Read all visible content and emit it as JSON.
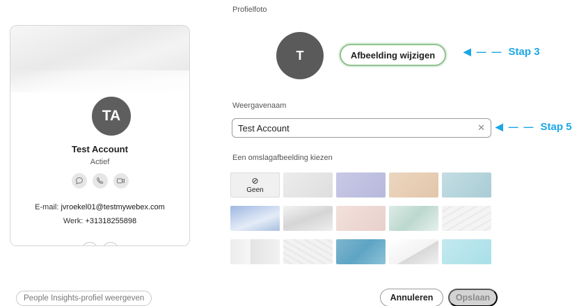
{
  "card": {
    "initials": "TA",
    "name": "Test Account",
    "status": "Actief",
    "email_label": "E-mail:",
    "email_value": "jvroekel01@testmywebex.com",
    "work_label": "Werk:",
    "work_value": "+31318255898",
    "icons": [
      "chat-icon",
      "phone-icon",
      "video-icon",
      "directory-icon",
      "mail-icon"
    ]
  },
  "insights_button": "People Insights-profiel weergeven",
  "profile_photo": {
    "label": "Profielfoto",
    "initial": "T",
    "change_button": "Afbeelding wijzigen"
  },
  "display_name": {
    "label": "Weergavenaam",
    "value": "Test Account"
  },
  "cover": {
    "label": "Een omslagafbeelding kiezen",
    "none_label": "Geen",
    "thumbnails": [
      {
        "name": "cover-none",
        "bg": "#f0f0f0"
      },
      {
        "name": "cover-light-grey",
        "bg": "linear-gradient(135deg,#ececec,#dedede)"
      },
      {
        "name": "cover-lavender",
        "bg": "linear-gradient(135deg,#c9c9e6,#b7b9dc)"
      },
      {
        "name": "cover-peach",
        "bg": "linear-gradient(135deg,#ecd6c0,#e2c6aa)"
      },
      {
        "name": "cover-teal-light",
        "bg": "linear-gradient(135deg,#c4dde3,#a9ccd5)"
      },
      {
        "name": "cover-blue-sky",
        "bg": "linear-gradient(160deg,#9fb7e2,#e4ecf7 60%,#a9bfdf)"
      },
      {
        "name": "cover-snow-peaks",
        "bg": "linear-gradient(160deg,#f3f3f3,#d5d5d5 50%,#eeeeee)"
      },
      {
        "name": "cover-blush",
        "bg": "linear-gradient(135deg,#f2e1dc,#e8d0cb)"
      },
      {
        "name": "cover-mint",
        "bg": "linear-gradient(135deg,#dcebe4,#bcd8cf 50%,#e6f0ec)"
      },
      {
        "name": "cover-white-curves",
        "bg": "repeating-linear-gradient(150deg,#f4f4f4 0px,#f4f4f4 6px,#e6e6e6 7px,#f4f4f4 9px)"
      },
      {
        "name": "cover-grey-panels",
        "bg": "linear-gradient(90deg,#ececec,#f6f6f6 40%,#e4e4e4 41%,#f1f1f1)"
      },
      {
        "name": "cover-white-texture",
        "bg": "repeating-linear-gradient(30deg,#f2f2f2 0px,#f2f2f2 5px,#e4e4e4 6px,#f2f2f2 8px)"
      },
      {
        "name": "cover-ocean",
        "bg": "linear-gradient(135deg,#7fb6cf,#5ea4c4 50%,#8cc2d8)"
      },
      {
        "name": "cover-white-fold",
        "bg": "linear-gradient(150deg,#ffffff 0%,#f3f3f3 55%,#d8d8d8 56%,#f0f0f0)"
      },
      {
        "name": "cover-aqua",
        "bg": "linear-gradient(135deg,#c3e9ef,#a9dfe8)"
      }
    ]
  },
  "annotations": {
    "step3": "Stap 3",
    "step5": "Stap 5",
    "dashes": "◀ — —"
  },
  "actions": {
    "cancel": "Annuleren",
    "save": "Opslaan"
  },
  "colors": {
    "annotation": "#1aa7e6",
    "highlight_border": "#8fc28f",
    "avatar": "#5a5a5a"
  }
}
